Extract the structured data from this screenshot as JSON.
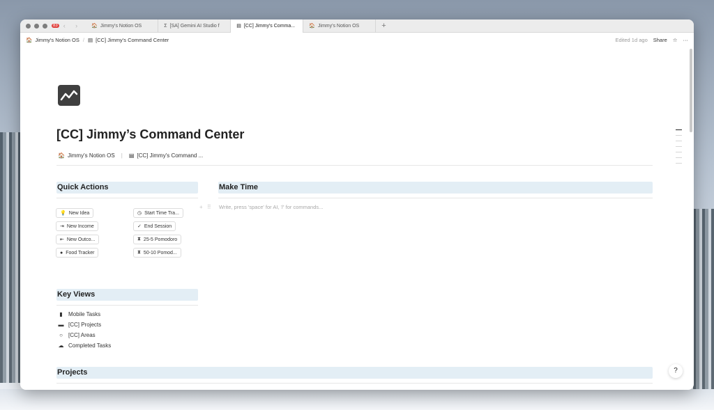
{
  "browser": {
    "badge": "83",
    "tabs": [
      {
        "icon": "house-icon",
        "glyph": "🏠",
        "label": "Jimmy's Notion OS"
      },
      {
        "icon": "sigma-icon",
        "glyph": "Σ",
        "label": "[SA] Gemini AI Studio f"
      },
      {
        "icon": "command-icon",
        "glyph": "▤",
        "label": "[CC] Jimmy's Comma..."
      },
      {
        "icon": "house-icon",
        "glyph": "🏠",
        "label": "Jimmy's Notion OS"
      }
    ],
    "new_tab": "+"
  },
  "topbar": {
    "crumb1": "Jimmy's Notion OS",
    "crumb2": "[CC] Jimmy's Command Center",
    "edited": "Edited 1d ago",
    "share": "Share",
    "star": "☆",
    "more": "···"
  },
  "page": {
    "title": "[CC] Jimmy’s Command Center",
    "inner_crumb1": "Jimmy's Notion OS",
    "inner_crumb2": "[CC] Jimmy's Command ..."
  },
  "quick_actions": {
    "heading": "Quick Actions",
    "left": [
      {
        "icon": "bulb-icon",
        "glyph": "💡",
        "label": "New Idea"
      },
      {
        "icon": "login-icon",
        "glyph": "⇥",
        "label": "New Income"
      },
      {
        "icon": "logout-icon",
        "glyph": "⇤",
        "label": "New Outco..."
      },
      {
        "icon": "apple-icon",
        "glyph": "●",
        "label": "Food Tracker"
      }
    ],
    "right": [
      {
        "icon": "clock-icon",
        "glyph": "◷",
        "label": "Start Time Tra..."
      },
      {
        "icon": "check-icon",
        "glyph": "✓",
        "label": "End Session"
      },
      {
        "icon": "hourglass-icon",
        "glyph": "⧗",
        "label": "25-5 Pomodoro"
      },
      {
        "icon": "hourglass-icon",
        "glyph": "⧗",
        "label": "50-10 Pomod..."
      }
    ]
  },
  "make_time": {
    "heading": "Make Time",
    "placeholder": "Write, press 'space' for AI, '/' for commands..."
  },
  "key_views": {
    "heading": "Key Views",
    "items": [
      {
        "icon": "phone-icon",
        "glyph": "▮",
        "label": "Mobile Tasks"
      },
      {
        "icon": "folder-icon",
        "glyph": "▬",
        "label": "[CC] Projects"
      },
      {
        "icon": "circle-icon",
        "glyph": "○",
        "label": "[CC] Areas"
      },
      {
        "icon": "cloud-check-icon",
        "glyph": "☁",
        "label": "Completed Tasks"
      }
    ]
  },
  "projects": {
    "heading": "Projects"
  },
  "help": "?"
}
